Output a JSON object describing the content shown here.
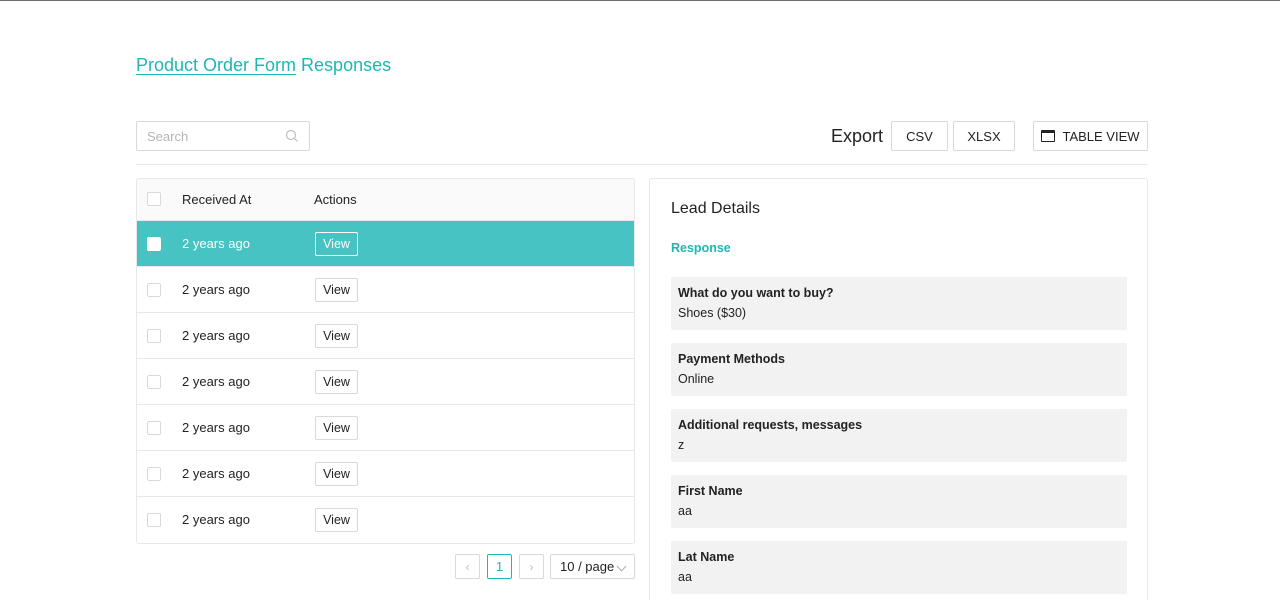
{
  "header": {
    "title_link": "Product Order Form",
    "title_rest": " Responses"
  },
  "toolbar": {
    "search_placeholder": "Search",
    "export_label": "Export",
    "csv_label": "CSV",
    "xlsx_label": "XLSX",
    "table_view_label": "TABLE VIEW"
  },
  "table": {
    "columns": [
      "Received At",
      "Actions"
    ],
    "rows": [
      {
        "received_at": "2 years ago",
        "action": "View"
      },
      {
        "received_at": "2 years ago",
        "action": "View"
      },
      {
        "received_at": "2 years ago",
        "action": "View"
      },
      {
        "received_at": "2 years ago",
        "action": "View"
      },
      {
        "received_at": "2 years ago",
        "action": "View"
      },
      {
        "received_at": "2 years ago",
        "action": "View"
      },
      {
        "received_at": "2 years ago",
        "action": "View"
      }
    ],
    "selected_row": 0
  },
  "pagination": {
    "prev": "‹",
    "current_page": "1",
    "next": "›",
    "page_size": "10 / page"
  },
  "details": {
    "title": "Lead Details",
    "section": "Response",
    "fields": [
      {
        "question": "What do you want to buy?",
        "answer": "Shoes ($30)"
      },
      {
        "question": "Payment Methods",
        "answer": "Online"
      },
      {
        "question": "Additional requests, messages",
        "answer": "z"
      },
      {
        "question": "First Name",
        "answer": "aa"
      },
      {
        "question": "Lat Name",
        "answer": "aa"
      }
    ]
  },
  "colors": {
    "accent": "#1fb6b4",
    "selected_row": "#46c3c2",
    "field_bg": "#f2f2f2"
  }
}
